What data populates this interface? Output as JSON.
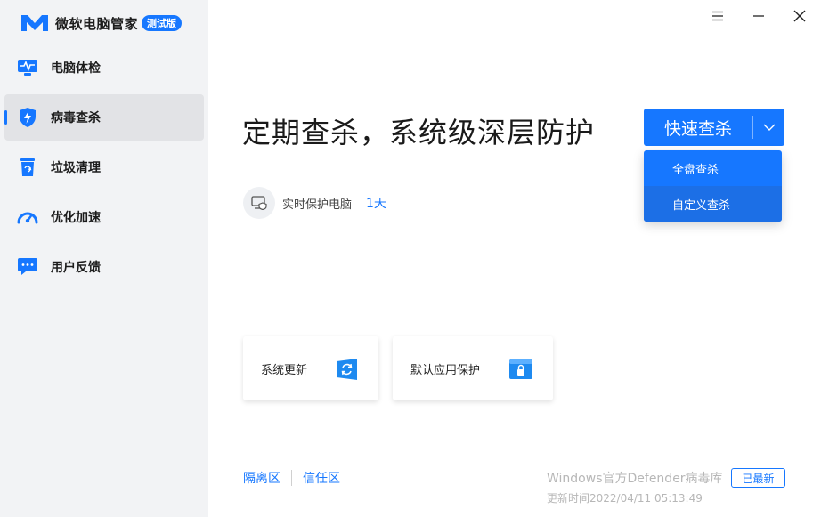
{
  "brand": {
    "title": "微软电脑管家",
    "badge": "测试版",
    "logo_icon": "tencent-style-m-logo"
  },
  "window_controls": {
    "menu_icon": "hamburger-icon",
    "minimize_icon": "minimize-icon",
    "close_icon": "close-icon"
  },
  "sidebar": {
    "items": [
      {
        "label": "电脑体检",
        "icon": "monitor-pulse-icon",
        "active": false
      },
      {
        "label": "病毒查杀",
        "icon": "shield-bolt-icon",
        "active": true
      },
      {
        "label": "垃圾清理",
        "icon": "recycle-bin-icon",
        "active": false
      },
      {
        "label": "优化加速",
        "icon": "speedometer-icon",
        "active": false
      },
      {
        "label": "用户反馈",
        "icon": "chat-bubble-icon",
        "active": false
      }
    ]
  },
  "main": {
    "headline": "定期查杀，系统级深层防护",
    "protection": {
      "label": "实时保护电脑",
      "days": "1天"
    },
    "scan_button": {
      "label": "快速查杀"
    },
    "scan_menu": {
      "items": [
        "全盘查杀",
        "自定义查杀"
      ]
    },
    "cards": [
      {
        "label": "系统更新",
        "icon": "refresh-window-icon"
      },
      {
        "label": "默认应用保护",
        "icon": "lock-window-icon"
      }
    ],
    "links": {
      "quarantine": "隔离区",
      "trusted": "信任区"
    },
    "defender": {
      "title": "Windows官方Defender病毒库",
      "updated": "更新时间2022/04/11 05:13:49",
      "status_button": "已最新"
    }
  },
  "colors": {
    "accent": "#1677ff",
    "sidebar_bg": "#f2f3f5",
    "sidebar_active_bg": "#e2e3e6",
    "muted_text": "#b7b7b7"
  }
}
